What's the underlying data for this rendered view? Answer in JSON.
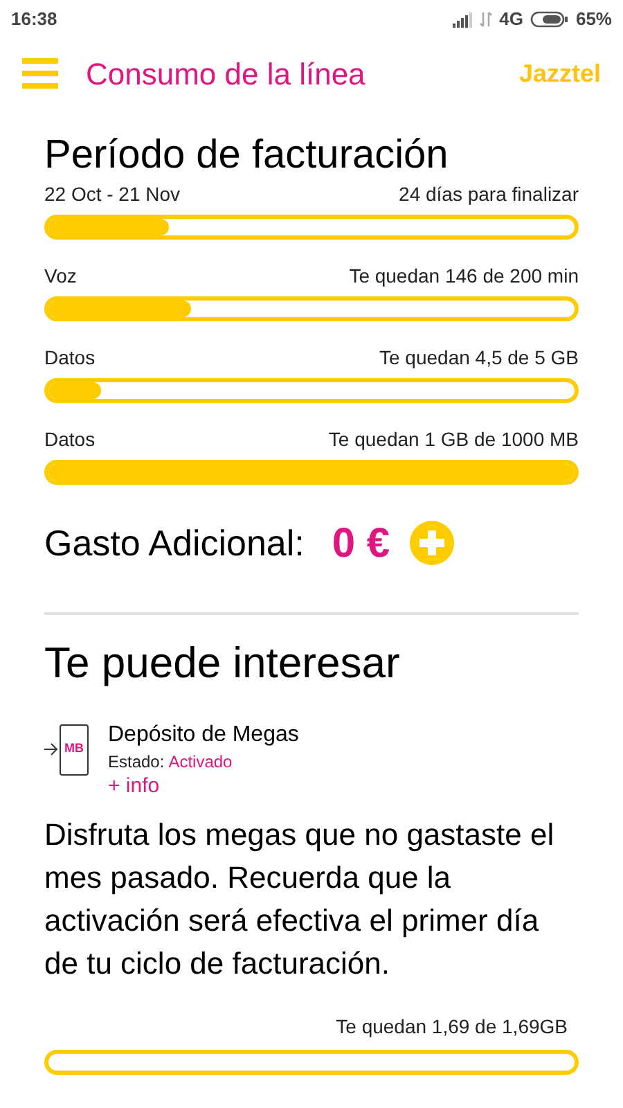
{
  "status_bar": {
    "time": "16:38",
    "network": "4G",
    "battery": "65%"
  },
  "header": {
    "title": "Consumo de la línea",
    "brand": "Jazztel"
  },
  "billing": {
    "title": "Período de facturación",
    "period": "22 Oct - 21 Nov",
    "remaining": "24 días para finalizar",
    "level": 0.23
  },
  "meters": [
    {
      "label": "Voz",
      "reading": "Te quedan 146 de 200 min",
      "level": 0.27
    },
    {
      "label": "Datos",
      "reading": "Te quedan 4,5 de 5 GB",
      "level": 0.1
    },
    {
      "label": "Datos",
      "reading": "Te quedan 1 GB de 1000 MB",
      "level": 1.0
    }
  ],
  "extra": {
    "label": "Gasto Adicional:",
    "amount": "0 €"
  },
  "offers": {
    "title": "Te puede interesar",
    "item": {
      "icon_text": "MB",
      "name": "Depósito de Megas",
      "state_label": "Estado:",
      "state": "Activado",
      "link": "+ info"
    },
    "description": "Disfruta los megas que no gastaste el mes pasado. Recuerda que la activación será efectiva el primer día de tu ciclo de facturación.",
    "meter": {
      "reading": "Te quedan 1,69 de 1,69GB",
      "level": 0
    }
  }
}
